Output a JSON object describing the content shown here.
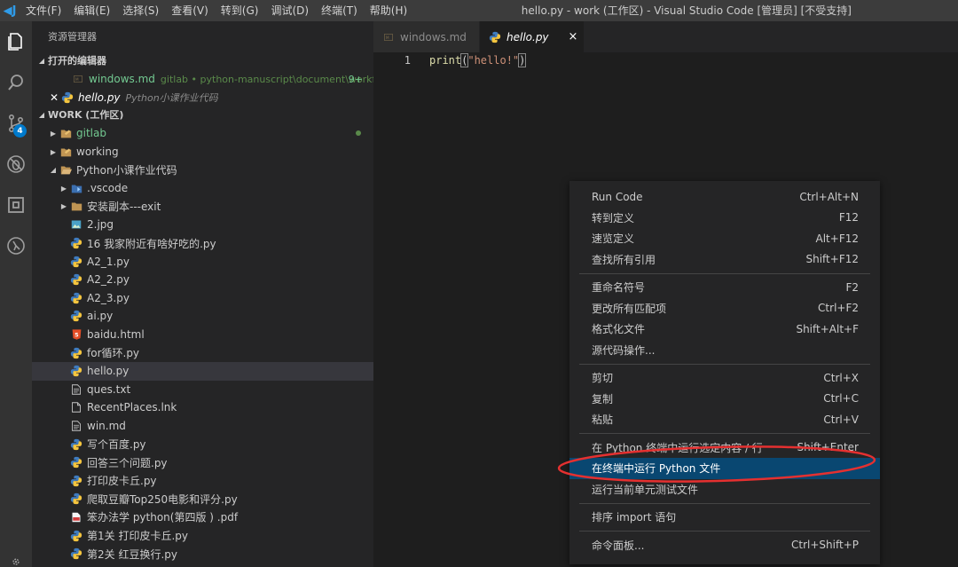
{
  "titlebar": {
    "logo": "◀J",
    "menus": [
      "文件(F)",
      "编辑(E)",
      "选择(S)",
      "查看(V)",
      "转到(G)",
      "调试(D)",
      "终端(T)",
      "帮助(H)"
    ],
    "title": "hello.py - work (工作区) - Visual Studio Code [管理员] [不受支持]"
  },
  "activity": {
    "scm_badge": "4"
  },
  "sidebar": {
    "title": "资源管理器",
    "open_editors_label": "打开的编辑器",
    "open_editors": [
      {
        "name": "windows.md",
        "desc": "gitlab • python-manuscript\\document\\workfl...",
        "mod": "9+"
      },
      {
        "name": "hello.py",
        "desc": "Python小课作业代码"
      }
    ],
    "workspace_label": "WORK (工作区)",
    "tree": [
      {
        "name": "gitlab",
        "level": 0,
        "kind": "folder",
        "green": true
      },
      {
        "name": "working",
        "level": 0,
        "kind": "folder"
      },
      {
        "name": "Python小课作业代码",
        "level": 0,
        "kind": "folder-open"
      },
      {
        "name": ".vscode",
        "level": 1,
        "kind": "folder-vscode"
      },
      {
        "name": "安装副本---exit",
        "level": 1,
        "kind": "folder-plain"
      },
      {
        "name": "2.jpg",
        "level": 1,
        "kind": "image"
      },
      {
        "name": "16 我家附近有啥好吃的.py",
        "level": 1,
        "kind": "py"
      },
      {
        "name": "A2_1.py",
        "level": 1,
        "kind": "py"
      },
      {
        "name": "A2_2.py",
        "level": 1,
        "kind": "py"
      },
      {
        "name": "A2_3.py",
        "level": 1,
        "kind": "py"
      },
      {
        "name": "ai.py",
        "level": 1,
        "kind": "py"
      },
      {
        "name": "baidu.html",
        "level": 1,
        "kind": "html"
      },
      {
        "name": "for循环.py",
        "level": 1,
        "kind": "py"
      },
      {
        "name": "hello.py",
        "level": 1,
        "kind": "py",
        "selected": true
      },
      {
        "name": "ques.txt",
        "level": 1,
        "kind": "txt"
      },
      {
        "name": "RecentPlaces.lnk",
        "level": 1,
        "kind": "file"
      },
      {
        "name": "win.md",
        "level": 1,
        "kind": "txt"
      },
      {
        "name": "写个百度.py",
        "level": 1,
        "kind": "py"
      },
      {
        "name": "回答三个问题.py",
        "level": 1,
        "kind": "py"
      },
      {
        "name": "打印皮卡丘.py",
        "level": 1,
        "kind": "py"
      },
      {
        "name": "爬取豆瓣Top250电影和评分.py",
        "level": 1,
        "kind": "py"
      },
      {
        "name": "笨办法学 python(第四版 ) .pdf",
        "level": 1,
        "kind": "pdf"
      },
      {
        "name": "第1关 打印皮卡丘.py",
        "level": 1,
        "kind": "py"
      },
      {
        "name": "第2关 红豆换行.py",
        "level": 1,
        "kind": "py"
      }
    ]
  },
  "tabs": [
    {
      "label": "windows.md",
      "active": false
    },
    {
      "label": "hello.py",
      "active": true,
      "close": "×"
    }
  ],
  "editor": {
    "line_number": "1",
    "func": "print",
    "open_paren": "(",
    "string": "\"hello!\"",
    "close_paren": ")"
  },
  "context_menu": {
    "groups": [
      [
        {
          "label": "Run Code",
          "shortcut": "Ctrl+Alt+N"
        },
        {
          "label": "转到定义",
          "shortcut": "F12"
        },
        {
          "label": "速览定义",
          "shortcut": "Alt+F12"
        },
        {
          "label": "查找所有引用",
          "shortcut": "Shift+F12"
        }
      ],
      [
        {
          "label": "重命名符号",
          "shortcut": "F2"
        },
        {
          "label": "更改所有匹配项",
          "shortcut": "Ctrl+F2"
        },
        {
          "label": "格式化文件",
          "shortcut": "Shift+Alt+F"
        },
        {
          "label": "源代码操作...",
          "shortcut": ""
        }
      ],
      [
        {
          "label": "剪切",
          "shortcut": "Ctrl+X"
        },
        {
          "label": "复制",
          "shortcut": "Ctrl+C"
        },
        {
          "label": "粘贴",
          "shortcut": "Ctrl+V"
        }
      ],
      [
        {
          "label": "在 Python 终端中运行选定内容 / 行",
          "shortcut": "Shift+Enter"
        },
        {
          "label": "在终端中运行 Python 文件",
          "shortcut": "",
          "active": true
        },
        {
          "label": "运行当前单元测试文件",
          "shortcut": ""
        }
      ],
      [
        {
          "label": "排序 import 语句",
          "shortcut": ""
        }
      ],
      [
        {
          "label": "命令面板...",
          "shortcut": "Ctrl+Shift+P"
        }
      ]
    ]
  },
  "colors": {
    "accent": "#007acc",
    "menu_highlight": "#094771",
    "annotation_red": "#e53030"
  }
}
